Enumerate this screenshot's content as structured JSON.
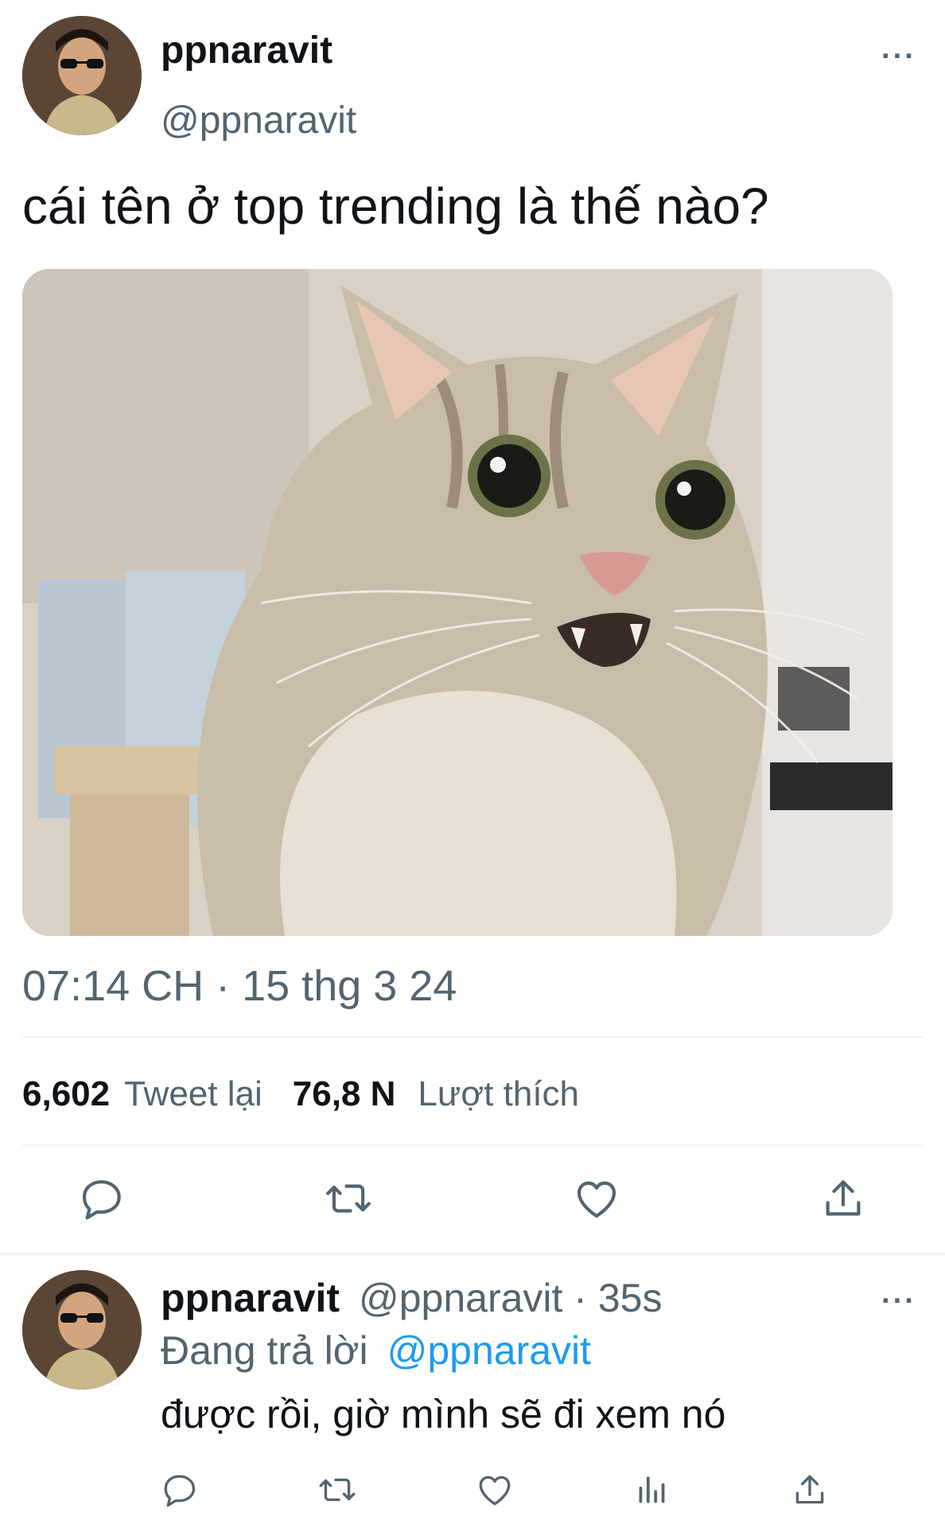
{
  "tweet": {
    "display_name": "ppnaravit",
    "handle": "@ppnaravit",
    "text": "cái tên ở top trending là thế nào?",
    "timestamp": "07:14 CH · 15 thg 3 24",
    "retweets_count": "6,602",
    "retweets_label": "Tweet lại",
    "likes_count": "76,8 N",
    "likes_label": "Lượt thích",
    "more": "···"
  },
  "reply": {
    "display_name": "ppnaravit",
    "handle_time": "@ppnaravit · 35s",
    "replying_prefix": "Đang trả lời",
    "replying_to": "@ppnaravit",
    "text": "được rồi, giờ mình sẽ đi xem nó",
    "more": "···"
  },
  "icons": {
    "actions": [
      "reply-icon",
      "retweet-icon",
      "like-icon",
      "share-icon"
    ],
    "reply_actions": [
      "reply-icon",
      "retweet-icon",
      "like-icon",
      "views-icon",
      "share-icon"
    ]
  },
  "colors": {
    "accent": "#1d9bf0",
    "secondary_text": "#536471",
    "divider": "#eff3f4"
  }
}
